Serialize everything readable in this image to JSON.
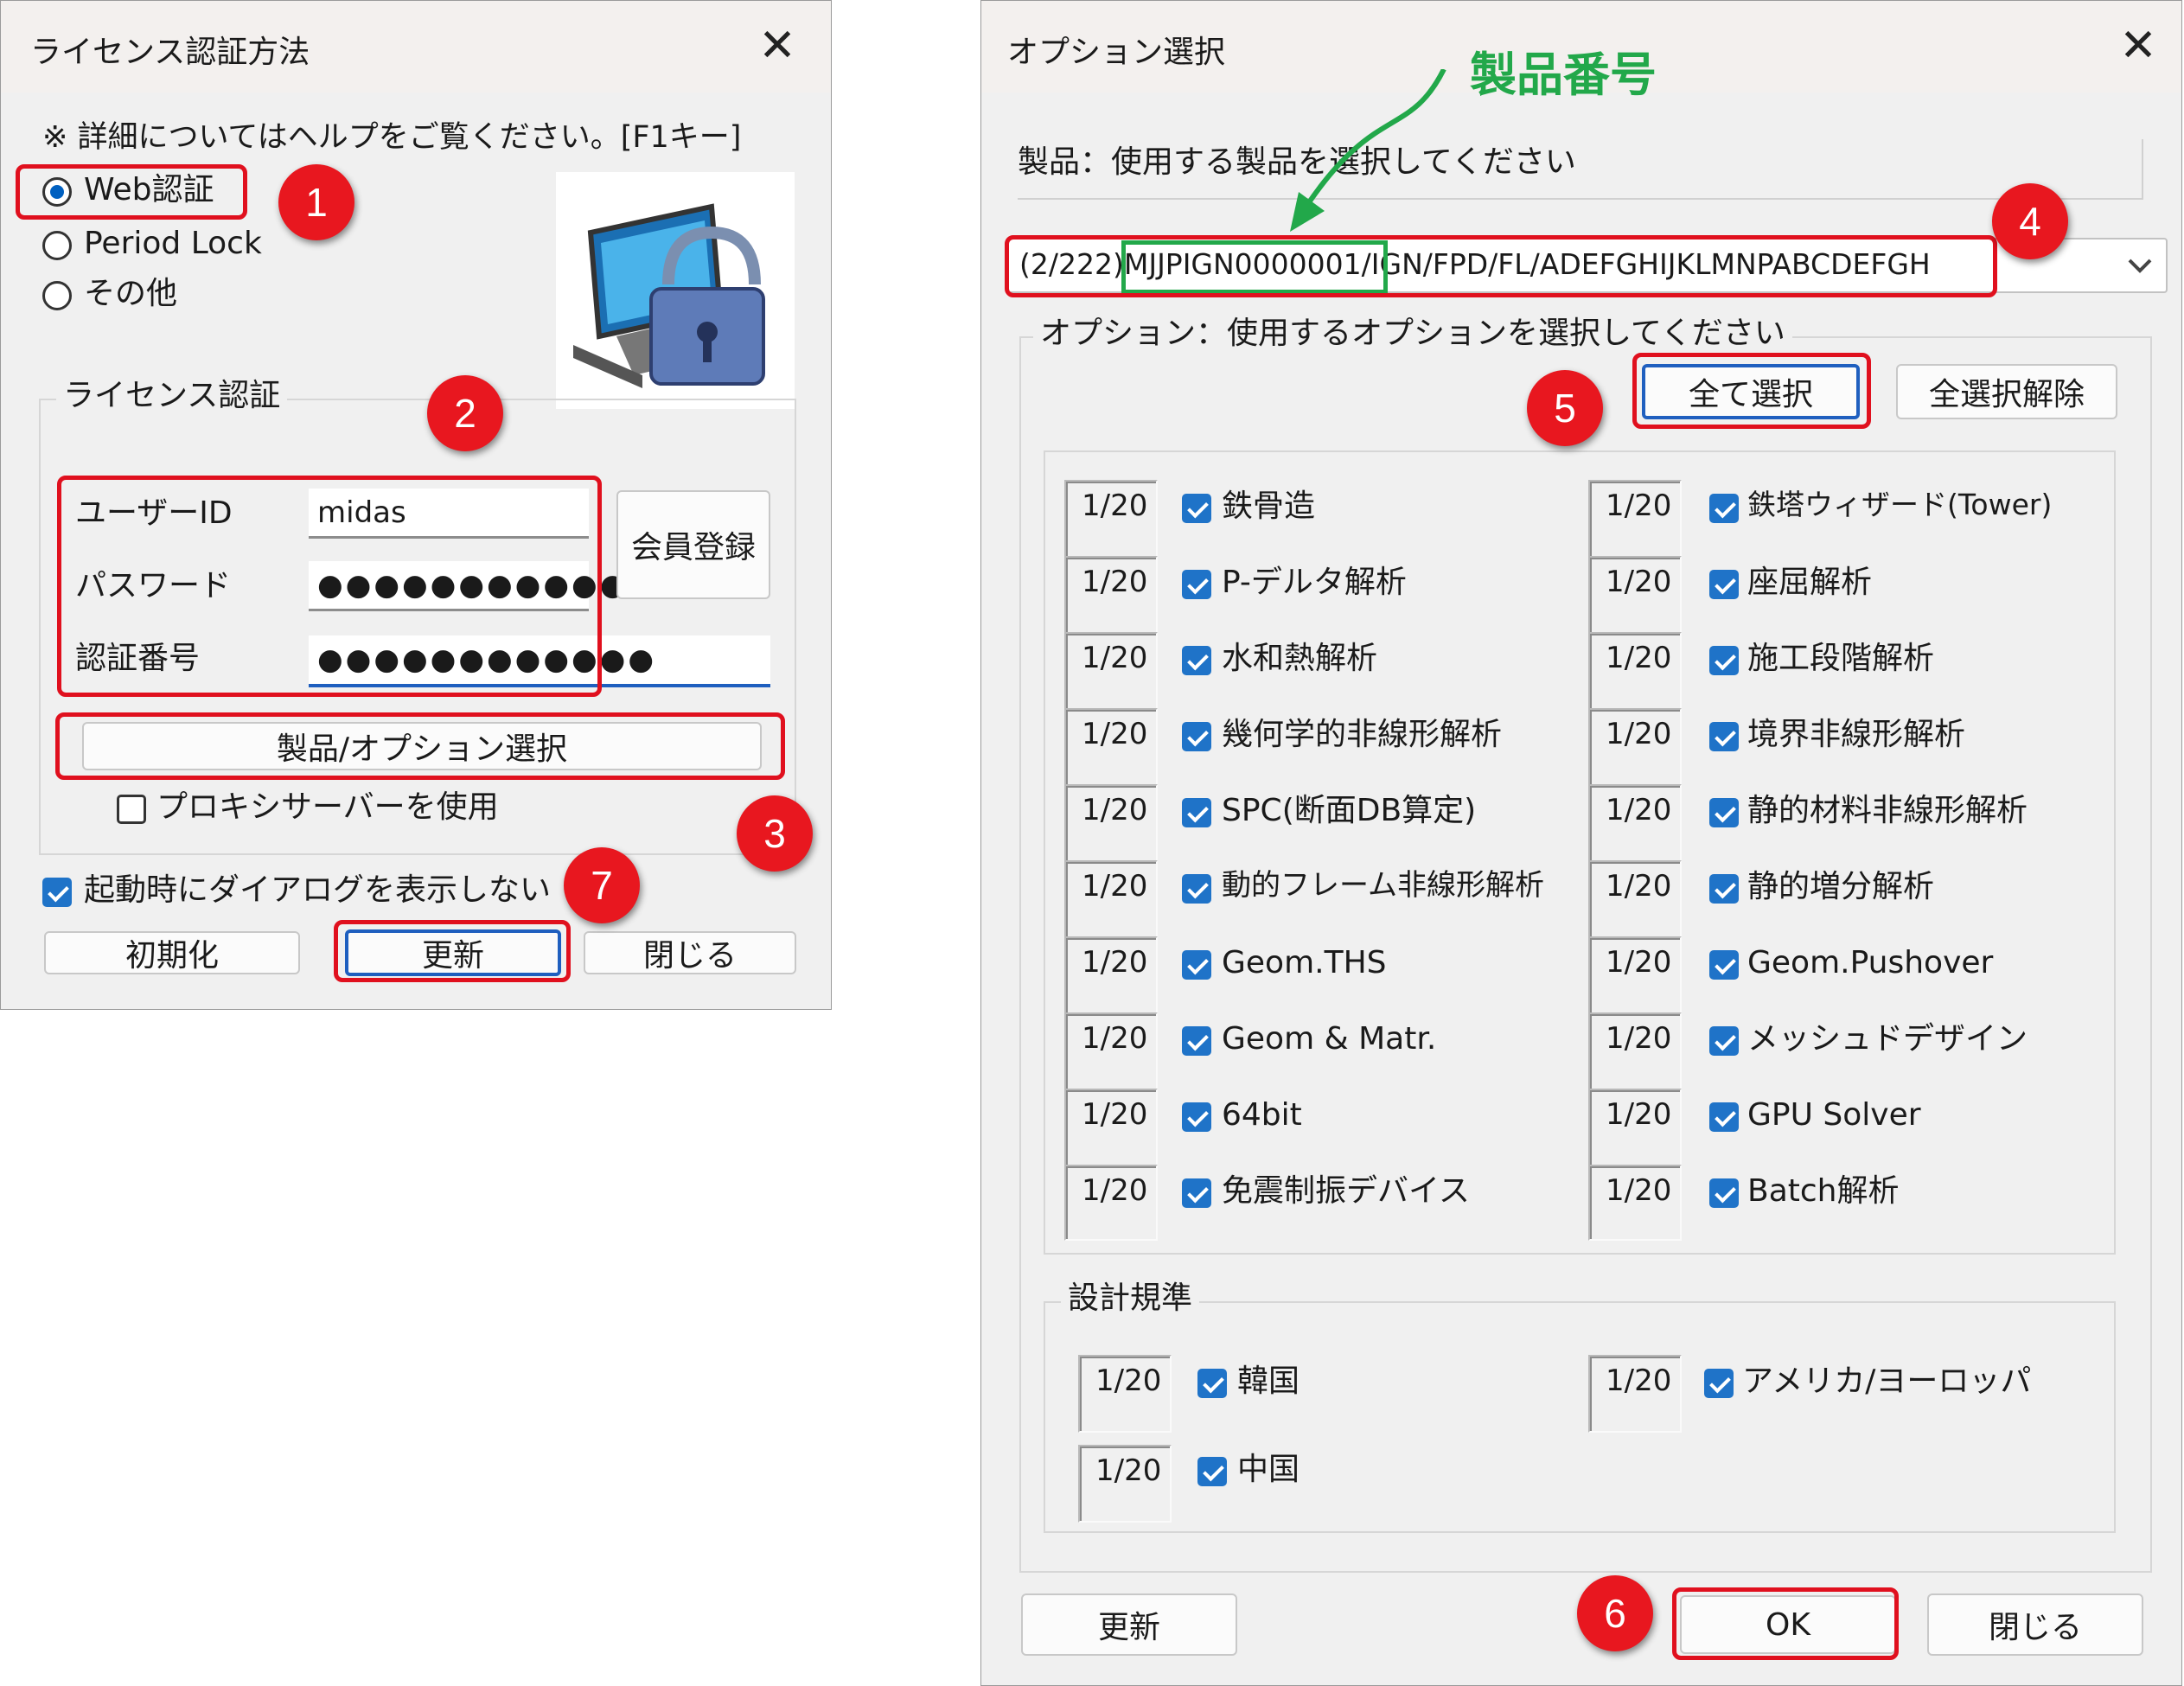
{
  "left_dialog": {
    "title": "ライセンス認証方法",
    "close_glyph": "✕",
    "note": "※ 詳細についてはヘルプをご覧ください。[F1キー]",
    "radios": [
      {
        "label": "Web認証",
        "selected": true
      },
      {
        "label": "Period Lock",
        "selected": false
      },
      {
        "label": "その他",
        "selected": false
      }
    ],
    "group_label": "ライセンス認証",
    "user_id_label": "ユーザーID",
    "user_id_value": "midas",
    "password_label": "パスワード",
    "password_value": "●●●●●●●●●●●",
    "auth_label": "認証番号",
    "auth_value": "●●●●●●●●●●●●",
    "register_button": "会員登録",
    "product_option_button": "製品/オプション選択",
    "proxy_label": "プロキシサーバーを使用",
    "proxy_checked": false,
    "no_dialog_label": "起動時にダイアログを表示しない",
    "no_dialog_checked": true,
    "init_button": "初期化",
    "update_button": "更新",
    "close_button": "閉じる",
    "icon": "computer-lock-icon"
  },
  "right_dialog": {
    "title": "オプション選択",
    "close_glyph": "✕",
    "product_prompt": "製品：使用する製品を選択してください",
    "product_select_value": "(2/222)MJJPIGN0000001/IGN/FPD/FL/ADEFGHIJKLMNPABCDEFGH",
    "product_select_prefix": "(2/222)",
    "product_select_number": "MJJPIGN0000001",
    "product_select_suffix": "/IGN/FPD/FL/ADEFGHIJKLMNPABCDEFGH",
    "option_prompt": "オプション：使用するオプションを選択してください",
    "select_all_button": "全て選択",
    "deselect_all_button": "全選択解除",
    "options_left": [
      {
        "count": "1/20",
        "label": "鉄骨造"
      },
      {
        "count": "1/20",
        "label": "P-デルタ解析"
      },
      {
        "count": "1/20",
        "label": "水和熱解析"
      },
      {
        "count": "1/20",
        "label": "幾何学的非線形解析"
      },
      {
        "count": "1/20",
        "label": "SPC(断面DB算定)"
      },
      {
        "count": "1/20",
        "label": "動的フレーム非線形解析"
      },
      {
        "count": "1/20",
        "label": "Geom.THS"
      },
      {
        "count": "1/20",
        "label": "Geom & Matr."
      },
      {
        "count": "1/20",
        "label": "64bit"
      },
      {
        "count": "1/20",
        "label": "免震制振デバイス"
      }
    ],
    "options_right": [
      {
        "count": "1/20",
        "label": "鉄塔ウィザード(Tower)"
      },
      {
        "count": "1/20",
        "label": "座屈解析"
      },
      {
        "count": "1/20",
        "label": "施工段階解析"
      },
      {
        "count": "1/20",
        "label": "境界非線形解析"
      },
      {
        "count": "1/20",
        "label": "静的材料非線形解析"
      },
      {
        "count": "1/20",
        "label": "静的増分解析"
      },
      {
        "count": "1/20",
        "label": "Geom.Pushover"
      },
      {
        "count": "1/20",
        "label": "メッシュドデザイン"
      },
      {
        "count": "1/20",
        "label": "GPU Solver"
      },
      {
        "count": "1/20",
        "label": "Batch解析"
      }
    ],
    "design_group_label": "設計規準",
    "design_codes": [
      {
        "count": "1/20",
        "label": "韓国"
      },
      {
        "count": "1/20",
        "label": "アメリカ/ヨーロッパ"
      },
      {
        "count": "1/20",
        "label": "中国"
      }
    ],
    "update_button": "更新",
    "ok_button": "OK",
    "close_button": "閉じる"
  },
  "annotations": {
    "product_number_label": "製品番号",
    "badges": [
      "1",
      "2",
      "3",
      "4",
      "5",
      "6",
      "7"
    ],
    "highlight_color": "#e0101e",
    "product_number_color": "#22a84a"
  }
}
